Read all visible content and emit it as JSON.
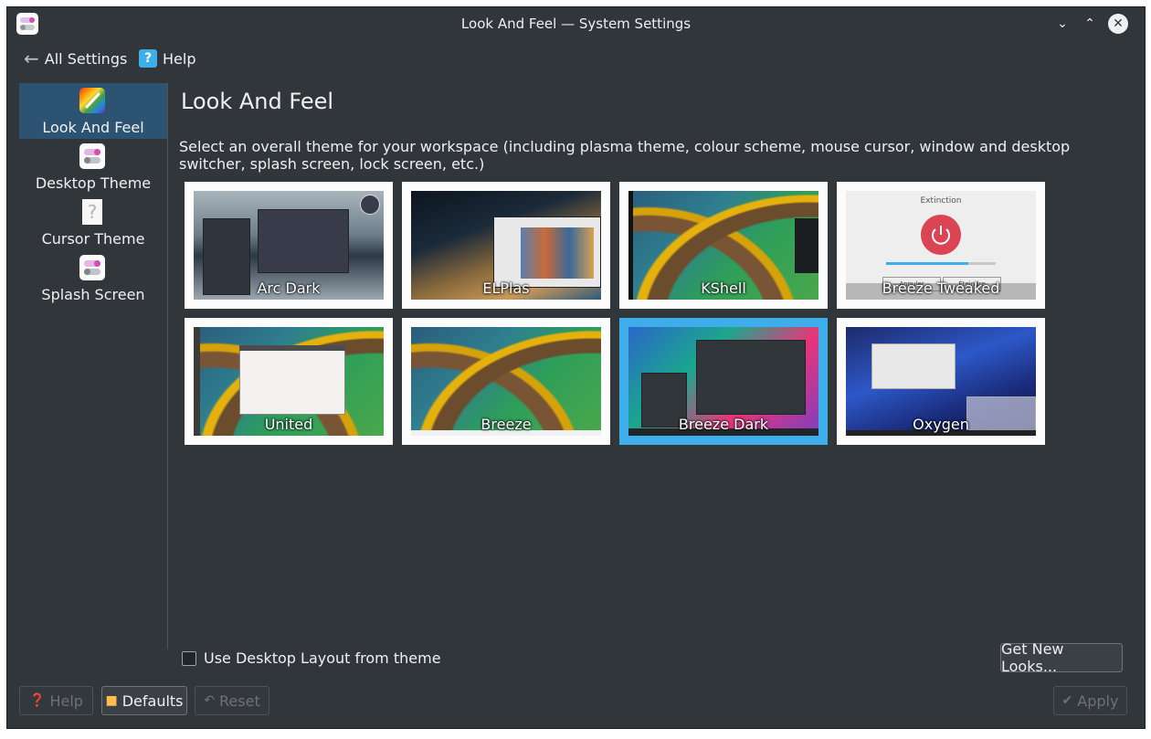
{
  "window": {
    "title": "Look And Feel — System Settings"
  },
  "toolbar": {
    "back_label": "All Settings",
    "help_label": "Help"
  },
  "sidebar": {
    "items": [
      {
        "label": "Look And Feel",
        "active": true
      },
      {
        "label": "Desktop Theme",
        "active": false
      },
      {
        "label": "Cursor Theme",
        "active": false
      },
      {
        "label": "Splash Screen",
        "active": false
      }
    ]
  },
  "main": {
    "title": "Look And Feel",
    "description": "Select an overall theme for your workspace (including plasma theme, colour scheme, mouse cursor, window and desktop switcher, splash screen, lock screen, etc.)",
    "themes": [
      {
        "name": "Arc Dark"
      },
      {
        "name": "ELPlas"
      },
      {
        "name": "KShell"
      },
      {
        "name": "Breeze Tweaked",
        "preview_title": "Extinction",
        "preview_btn1": "Annuler",
        "preview_btn2": "Éteindre"
      },
      {
        "name": "United"
      },
      {
        "name": "Breeze"
      },
      {
        "name": "Breeze Dark",
        "selected": true
      },
      {
        "name": "Oxygen"
      }
    ],
    "layout_checkbox_label": "Use Desktop Layout from theme",
    "layout_checkbox_checked": false,
    "get_new_label": "Get New Looks..."
  },
  "footer": {
    "help_label": "Help",
    "defaults_label": "Defaults",
    "reset_label": "Reset",
    "apply_label": "Apply"
  },
  "colors": {
    "window_bg": "#31363b",
    "accent": "#3daee9",
    "selection_bg": "#2c5372",
    "text": "#eff0f1"
  }
}
